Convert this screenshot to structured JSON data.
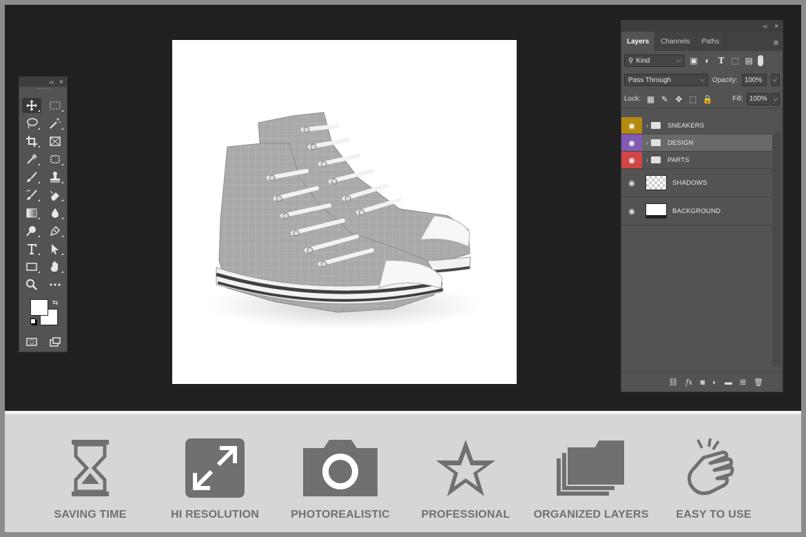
{
  "toolbox": {
    "collapse": "‹‹",
    "close": "×",
    "tools": [
      "move-tool",
      "rect-marquee-tool",
      "lasso-tool",
      "magic-wand-tool",
      "crop-tool",
      "frame-tool",
      "eyedropper-tool",
      "patch-tool",
      "brush-tool",
      "clone-stamp-tool",
      "history-brush-tool",
      "eraser-tool",
      "gradient-tool",
      "blur-tool",
      "dodge-tool",
      "pen-tool",
      "type-tool",
      "path-selection-tool",
      "rectangle-tool",
      "hand-tool",
      "zoom-tool",
      "more-tools"
    ]
  },
  "layers_panel": {
    "collapse": "‹‹",
    "close": "×",
    "tabs": [
      "Layers",
      "Channels",
      "Paths"
    ],
    "kind_label": "Kind",
    "blend_mode": "Pass Through",
    "opacity_label": "Opacity:",
    "opacity_value": "100%",
    "lock_label": "Lock:",
    "fill_label": "Fill:",
    "fill_value": "100%",
    "layers": [
      {
        "name": "SNEAKERS",
        "type": "group",
        "color": "#b58a10"
      },
      {
        "name": "DESIGN",
        "type": "group",
        "color": "#7f5bb4"
      },
      {
        "name": "PARTS",
        "type": "group",
        "color": "#d24545"
      },
      {
        "name": "SHADOWS",
        "type": "layer",
        "thumb": "transparent"
      },
      {
        "name": "BACKGROUND",
        "type": "layer",
        "thumb": "white"
      }
    ]
  },
  "features": [
    {
      "label": "SAVING TIME",
      "icon": "hourglass-icon"
    },
    {
      "label": "HI RESOLUTION",
      "icon": "expand-arrows-icon"
    },
    {
      "label": "PHOTOREALISTIC",
      "icon": "camera-icon"
    },
    {
      "label": "PROFESSIONAL",
      "icon": "star-icon"
    },
    {
      "label": "ORGANIZED LAYERS",
      "icon": "layered-folders-icon"
    },
    {
      "label": "EASY TO USE",
      "icon": "tap-hand-icon"
    }
  ],
  "colors": {
    "workspace": "#202020",
    "panel": "#535353",
    "feature_gray": "#707070"
  }
}
